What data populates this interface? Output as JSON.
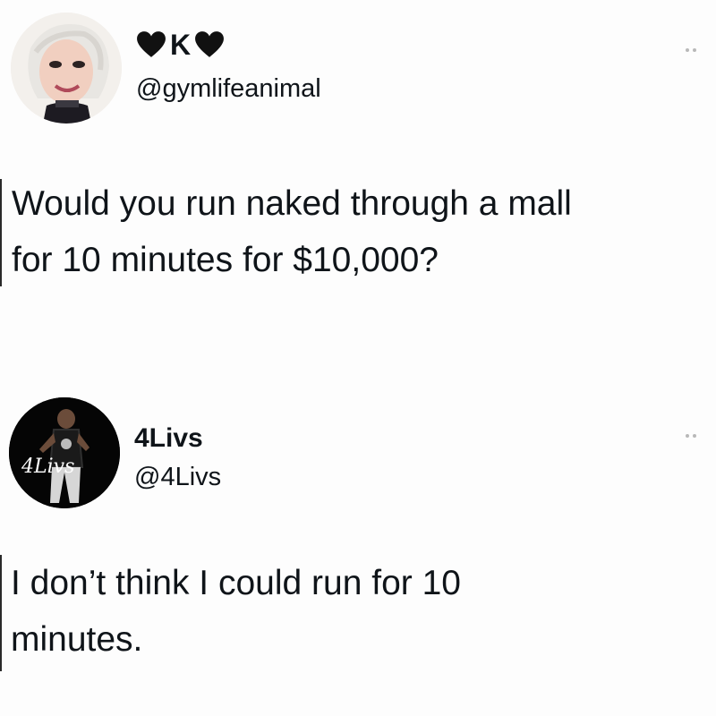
{
  "tweets": [
    {
      "display_name": "K",
      "handle": "@gymlifeanimal",
      "text_lines": [
        "Would you run naked through a mall",
        "for 10 minutes for $10,000?"
      ],
      "avatar_icon": "profile-photo",
      "name_icons": [
        "black-heart-icon",
        "black-heart-icon"
      ]
    },
    {
      "display_name": "4Livs",
      "handle": "@4Livs",
      "text_lines": [
        "I don’t think I could run for 10",
        "minutes."
      ],
      "avatar_icon": "profile-photo",
      "avatar_signature": "4Livs"
    }
  ],
  "colors": {
    "text": "#0f1419",
    "background": "#fdfdfd",
    "more_dots": "#b9b9b9"
  }
}
